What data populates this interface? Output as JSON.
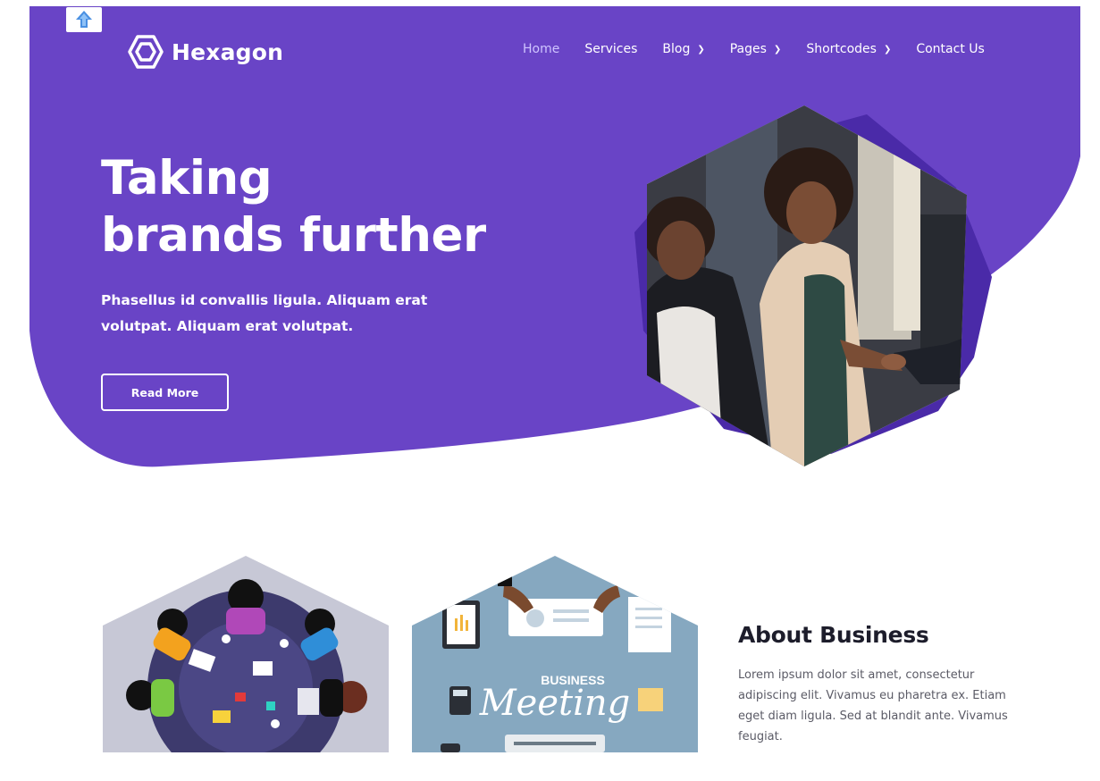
{
  "brand": {
    "name": "Hexagon"
  },
  "nav": {
    "items": [
      {
        "label": "Home",
        "active": true,
        "dropdown": false
      },
      {
        "label": "Services",
        "active": false,
        "dropdown": false
      },
      {
        "label": "Blog",
        "active": false,
        "dropdown": true
      },
      {
        "label": "Pages",
        "active": false,
        "dropdown": true
      },
      {
        "label": "Shortcodes",
        "active": false,
        "dropdown": true
      },
      {
        "label": "Contact Us",
        "active": false,
        "dropdown": false
      }
    ]
  },
  "hero": {
    "title_line1": "Taking",
    "title_line2": "brands further",
    "subtitle": "Phasellus id convallis ligula. Aliquam erat volutpat. Aliquam erat volutpat.",
    "button_label": "Read More"
  },
  "illustration": {
    "meeting_line1": "BUSINESS",
    "meeting_line2": "Meeting"
  },
  "about": {
    "title": "About Business",
    "text": "Lorem ipsum dolor sit amet, consectetur adipiscing elit. Vivamus eu pharetra ex. Etiam eget diam ligula. Sed at blandit ante. Vivamus feugiat."
  },
  "colors": {
    "primary": "#6944c6",
    "primary_dark": "#5234b0",
    "white": "#ffffff",
    "heading": "#1d1d2b",
    "body_text": "#5b5b66"
  },
  "icons": [
    "back-to-top-icon",
    "hexagon-logo-icon",
    "chevron-down-icon"
  ]
}
